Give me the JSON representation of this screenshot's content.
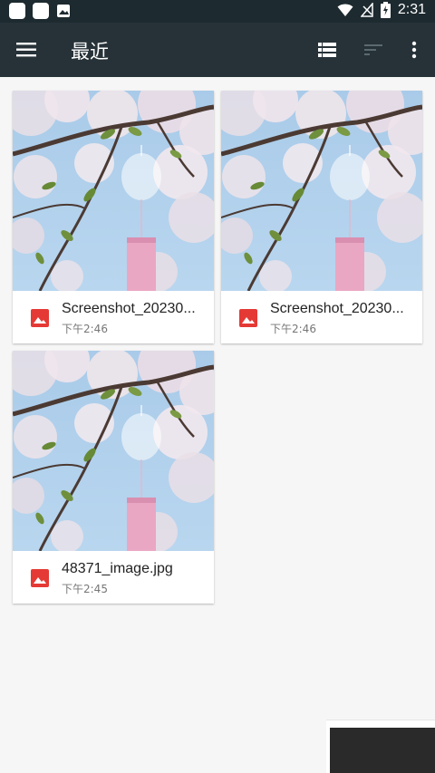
{
  "status_bar": {
    "time": "2:31",
    "icons": [
      "app-square-icon",
      "app-square-icon",
      "image-icon",
      "wifi-icon",
      "no-signal-icon",
      "battery-charging-icon"
    ]
  },
  "app_bar": {
    "title": "最近",
    "menu_icon": "hamburger-menu-icon",
    "actions": [
      "list-view-icon",
      "sort-icon",
      "more-vert-icon"
    ]
  },
  "files": [
    {
      "name": "Screenshot_20230...",
      "time": "下午2:46",
      "type_icon": "image-file-icon"
    },
    {
      "name": "Screenshot_20230...",
      "time": "下午2:46",
      "type_icon": "image-file-icon"
    },
    {
      "name": "48371_image.jpg",
      "time": "下午2:45",
      "type_icon": "image-file-icon"
    }
  ],
  "corner_overlay": {
    "text": ""
  },
  "colors": {
    "app_bar": "#263238",
    "status_bar": "#1d2a30",
    "file_icon": "#e53935",
    "background": "#f6f6f6"
  }
}
